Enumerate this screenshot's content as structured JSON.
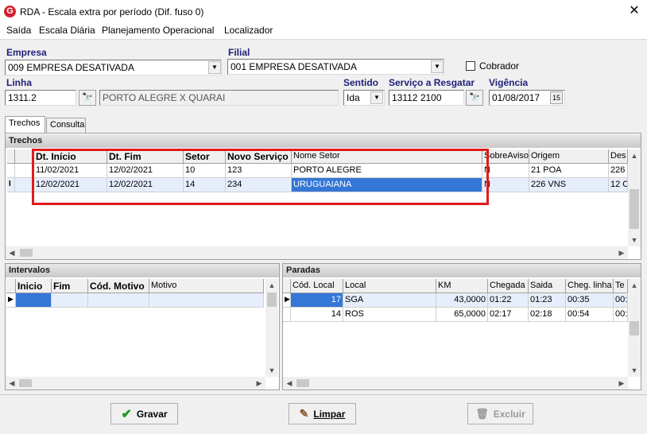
{
  "window": {
    "title": "RDA - Escala extra por período (Dif. fuso 0)",
    "icon_letter": "G"
  },
  "menu": [
    "Saída",
    "Escala Diária",
    "Planejamento Operacional",
    "Localizador"
  ],
  "form": {
    "empresa_label": "Empresa",
    "empresa_value": "009 EMPRESA DESATIVADA",
    "filial_label": "Filial",
    "filial_value": "001 EMPRESA DESATIVADA",
    "cobrador_label": "Cobrador",
    "linha_label": "Linha",
    "linha_value": "1311.2",
    "linha_desc": "PORTO ALEGRE X QUARAI",
    "sentido_label": "Sentido",
    "sentido_value": "Ida",
    "servico_label": "Serviço a Resgatar",
    "servico_value": "13112 2100",
    "vigencia_label": "Vigência",
    "vigencia_value": "01/08/2017",
    "calendar_glyph": "15"
  },
  "tabs": [
    "Trechos",
    "Consulta"
  ],
  "trechos": {
    "title": "Trechos",
    "columns": [
      "Dt. Início",
      "Dt. Fim",
      "Setor",
      "Novo Serviço",
      "Nome Setor",
      "SobreAviso",
      "Origem",
      "Des"
    ],
    "rows": [
      [
        "11/02/2021",
        "12/02/2021",
        "10",
        "123",
        "PORTO ALEGRE",
        "N",
        "21 POA",
        "226"
      ],
      [
        "12/02/2021",
        "12/02/2021",
        "14",
        "234",
        "URUGUAIANA",
        "N",
        "226 VNS",
        "12 C"
      ]
    ],
    "row_indicator": "I"
  },
  "intervalos": {
    "title": "Intervalos",
    "columns": [
      "Inicio",
      "Fim",
      "Cód. Motivo",
      "Motivo"
    ]
  },
  "paradas": {
    "title": "Paradas",
    "columns": [
      "Cód. Local",
      "Local",
      "KM",
      "Chegada",
      "Saida",
      "Cheg. linha",
      "Te"
    ],
    "rows": [
      [
        "17",
        "SGA",
        "43,0000",
        "01:22",
        "01:23",
        "00:35",
        "00:"
      ],
      [
        "14",
        "ROS",
        "65,0000",
        "02:17",
        "02:18",
        "00:54",
        "00:"
      ]
    ]
  },
  "buttons": {
    "gravar": "Gravar",
    "limpar": "Limpar",
    "excluir": "Excluir"
  }
}
